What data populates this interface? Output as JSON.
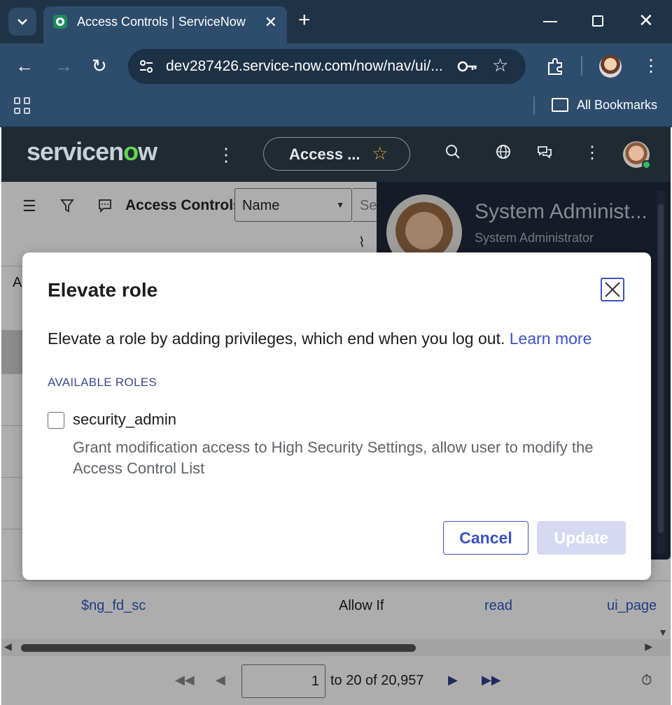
{
  "browser": {
    "tab_title": "Access Controls | ServiceNow",
    "url": "dev287426.service-now.com/now/nav/ui/...",
    "bookmarks_label": "All Bookmarks",
    "accent_color": "#2e4c6b"
  },
  "sn_header": {
    "logo_text_a": "servicen",
    "logo_text_o": "o",
    "logo_text_b": "w",
    "pill_label": "Access ..."
  },
  "list": {
    "title": "Access Controls",
    "filter_field": "Name",
    "search_placeholder": "Sea",
    "column_header_initial": "A",
    "visible_row": {
      "name": "$ng_fd_sc",
      "decision_type": "Allow If",
      "operation": "read",
      "type": "ui_page"
    }
  },
  "pager": {
    "page_value": "1",
    "range_text": "to 20 of 20,957"
  },
  "profile": {
    "name": "System Administ...",
    "role": "System Administrator"
  },
  "modal": {
    "title": "Elevate role",
    "description": "Elevate a role by adding privileges, which end when you log out.",
    "learn_more": "Learn more",
    "section_label": "AVAILABLE ROLES",
    "roles": [
      {
        "name": "security_admin",
        "checked": false,
        "description": "Grant modification access to High Security Settings, allow user to modify the Access Control List"
      }
    ],
    "cancel_label": "Cancel",
    "update_label": "Update",
    "primary_color": "#3b51c4"
  }
}
